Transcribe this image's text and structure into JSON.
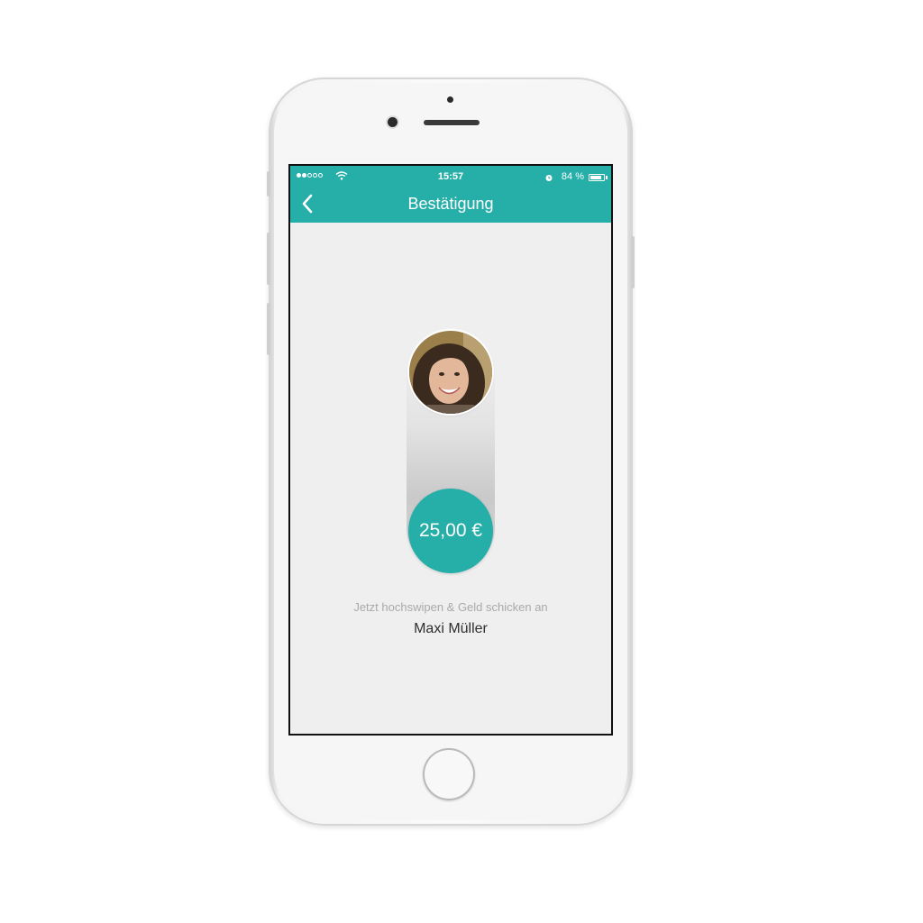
{
  "status_bar": {
    "time": "15:57",
    "battery_percent": "84 %",
    "battery_level": 0.84,
    "signal_bars_filled": 2,
    "signal_bars_total": 5
  },
  "nav": {
    "title": "Bestätigung"
  },
  "payment": {
    "amount": "25,00 €",
    "hint": "Jetzt hochswipen & Geld schicken an",
    "recipient": "Maxi Müller"
  },
  "colors": {
    "accent": "#26aea9",
    "screen_bg": "#efefef"
  },
  "icons": {
    "back": "chevron-left-icon",
    "wifi": "wifi-icon",
    "alarm": "alarm-icon",
    "battery": "battery-icon"
  }
}
